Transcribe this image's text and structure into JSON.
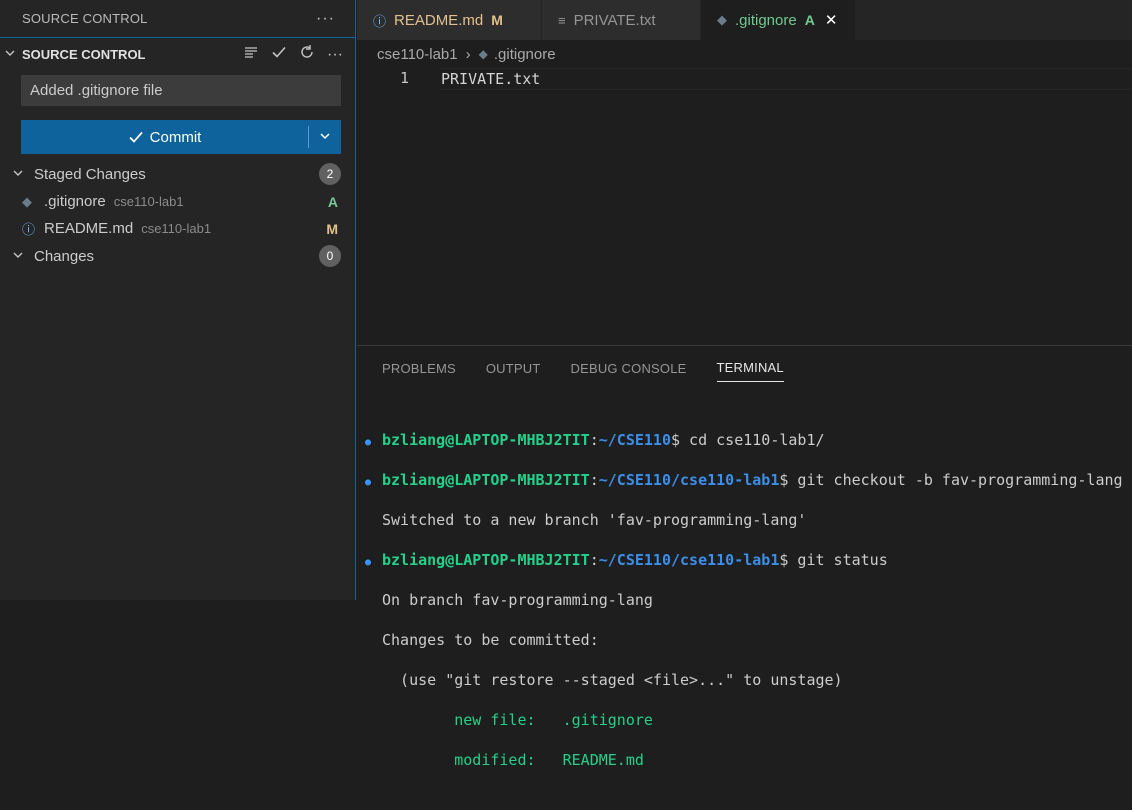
{
  "sidebar": {
    "header": "SOURCE CONTROL",
    "section_title": "SOURCE CONTROL",
    "message": "Added .gitignore file",
    "commit_label": "Commit",
    "staged": {
      "label": "Staged Changes",
      "count": "2"
    },
    "staged_files": [
      {
        "name": ".gitignore",
        "dir": "cse110-lab1",
        "status": "A",
        "icon": "git-file-icon"
      },
      {
        "name": "README.md",
        "dir": "cse110-lab1",
        "status": "M",
        "icon": "info-icon"
      }
    ],
    "changes": {
      "label": "Changes",
      "count": "0"
    }
  },
  "tabs": [
    {
      "name": "README.md",
      "badge": "M"
    },
    {
      "name": "PRIVATE.txt"
    },
    {
      "name": ".gitignore",
      "badge": "A"
    }
  ],
  "breadcrumb": {
    "folder": "cse110-lab1",
    "file": ".gitignore"
  },
  "editor": {
    "line_number": "1",
    "line_text": "PRIVATE.txt"
  },
  "panel_tabs": [
    "PROBLEMS",
    "OUTPUT",
    "DEBUG CONSOLE",
    "TERMINAL"
  ],
  "terminal": {
    "user": "bzliang@LAPTOP-MHBJ2TIT",
    "lines": [
      {
        "path": "~/CSE110",
        "cmd": "$ cd cse110-lab1/"
      },
      {
        "path": "~/CSE110/cse110-lab1",
        "cmd": "$ git checkout -b fav-programming-lang"
      },
      {
        "output": "Switched to a new branch 'fav-programming-lang'"
      },
      {
        "path": "~/CSE110/cse110-lab1",
        "cmd": "$ git status"
      },
      {
        "output": "On branch fav-programming-lang"
      },
      {
        "output": "Changes to be committed:"
      },
      {
        "output": "  (use \"git restore --staged <file>...\" to unstage)"
      },
      {
        "green_label": "new file:",
        "green_value": ".gitignore"
      },
      {
        "green_label": "modified:",
        "green_value": "README.md"
      }
    ]
  },
  "colors": {
    "accent": "#0e639c",
    "added": "#73c991",
    "modified": "#e2c08d",
    "prompt_user": "#23d18b",
    "prompt_path": "#3b8eea"
  }
}
